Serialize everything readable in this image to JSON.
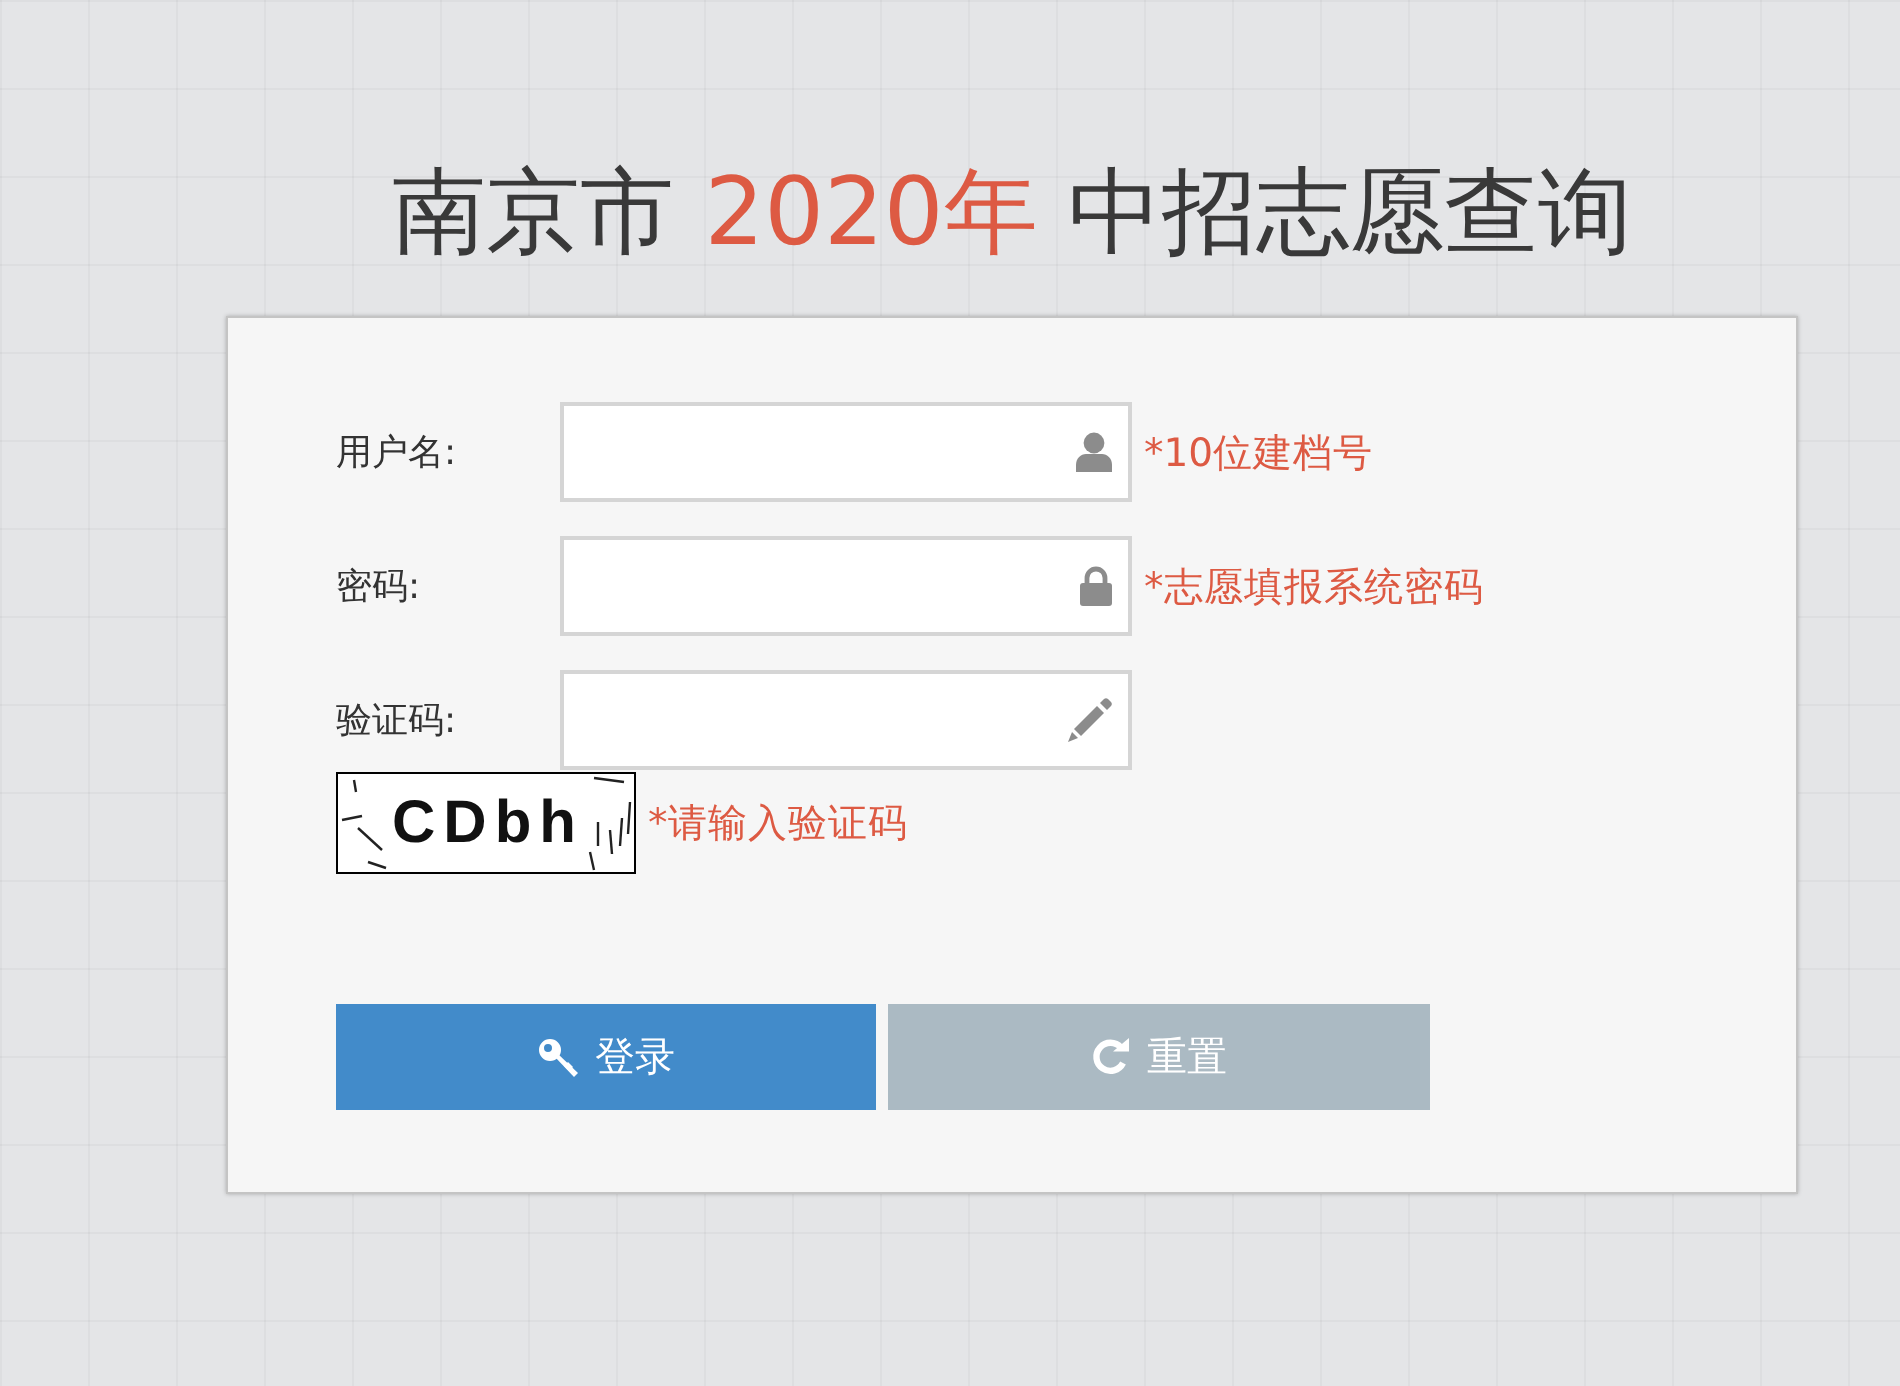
{
  "title": {
    "segments": [
      {
        "text": "南京市 ",
        "accent": false
      },
      {
        "text": "2020年",
        "accent": true
      },
      {
        "text": " 中招志愿查询",
        "accent": false
      }
    ]
  },
  "form": {
    "fields": [
      {
        "kind": "username",
        "label": "用户名:",
        "hint": "*10位建档号"
      },
      {
        "kind": "password",
        "label": "密码:",
        "hint": "*志愿填报系统密码"
      },
      {
        "kind": "captcha",
        "label": "验证码:"
      }
    ],
    "captcha": {
      "text": "CDbh",
      "hint": "*请输入验证码"
    },
    "buttons": [
      {
        "kind": "submit",
        "label": "登录"
      },
      {
        "kind": "reset",
        "label": "重置"
      }
    ]
  }
}
